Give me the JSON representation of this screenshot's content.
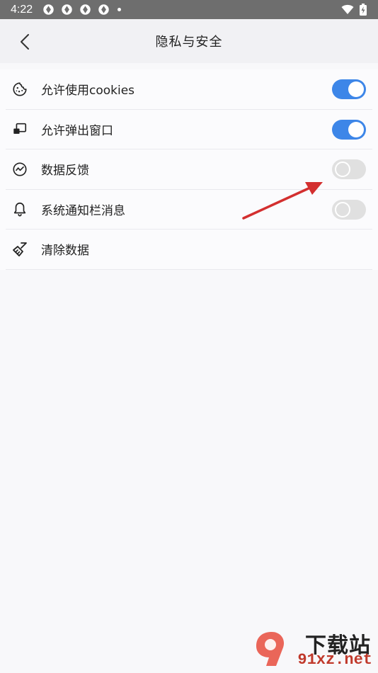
{
  "status_bar": {
    "time": "4:22"
  },
  "header": {
    "title": "隐私与安全"
  },
  "settings": {
    "items": [
      {
        "label": "允许使用cookies",
        "icon": "cookie-icon",
        "toggle": "on"
      },
      {
        "label": "允许弹出窗口",
        "icon": "popup-window-icon",
        "toggle": "on"
      },
      {
        "label": "数据反馈",
        "icon": "chart-circle-icon",
        "toggle": "off"
      },
      {
        "label": "系统通知栏消息",
        "icon": "bell-icon",
        "toggle": "off"
      },
      {
        "label": "清除数据",
        "icon": "broom-icon",
        "toggle": null
      }
    ]
  },
  "watermark": {
    "title": "下载站",
    "url": "91xz.net"
  },
  "colors": {
    "accent": "#3d86e8",
    "annotation": "#d32f2f",
    "status_bar": "#6e6e6e"
  }
}
